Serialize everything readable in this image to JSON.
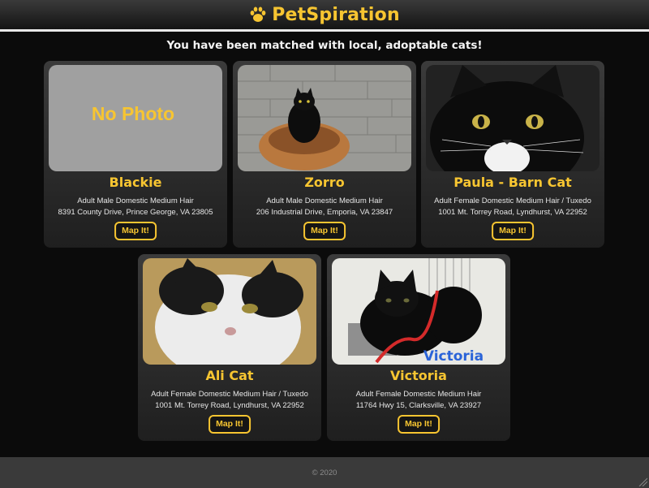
{
  "header": {
    "brand_name": "PetSpiration"
  },
  "subtitle": "You have been matched with local, adoptable cats!",
  "cats": [
    {
      "name": "Blackie",
      "description": "Adult Male Domestic Medium Hair",
      "address": "8391 County Drive, Prince George, VA 23805",
      "button": "Map It!",
      "photo_label": "No Photo"
    },
    {
      "name": "Zorro",
      "description": "Adult Male Domestic Medium Hair",
      "address": "206 Industrial Drive, Emporia, VA 23847",
      "button": "Map It!"
    },
    {
      "name": "Paula - Barn Cat",
      "description": "Adult Female Domestic Medium Hair / Tuxedo",
      "address": "1001 Mt. Torrey Road, Lyndhurst, VA 22952",
      "button": "Map It!"
    },
    {
      "name": "Ali Cat",
      "description": "Adult Female Domestic Medium Hair / Tuxedo",
      "address": "1001 Mt. Torrey Road, Lyndhurst, VA 22952",
      "button": "Map It!"
    },
    {
      "name": "Victoria",
      "description": "Adult Female Domestic Medium Hair",
      "address": "11764 Hwy 15, Clarksville, VA 23927",
      "button": "Map It!",
      "photo_label": "Victoria"
    }
  ],
  "footer": {
    "copyright": "© 2020"
  },
  "colors": {
    "accent": "#f7c531",
    "background": "#0b0b0b",
    "card": "#2d2d2d",
    "footer": "#3a3a3a"
  }
}
